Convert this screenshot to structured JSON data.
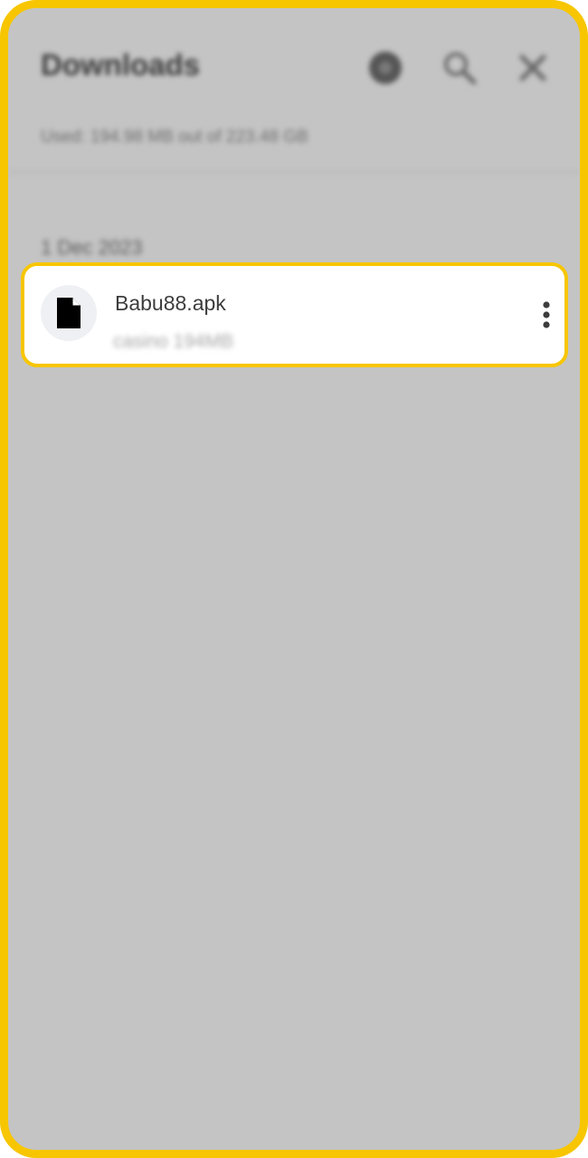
{
  "header": {
    "title": "Downloads",
    "icons": [
      "settings-icon",
      "search-icon",
      "close-icon"
    ]
  },
  "storage": {
    "text": "Used: 194.98 MB out of 223.48 GB"
  },
  "list": {
    "date_header": "1 Dec 2023",
    "items": [
      {
        "file_name": "Babu88.apk",
        "meta": "casino 194MB",
        "icon": "file-icon",
        "menu_icon": "more-vert-icon"
      }
    ]
  },
  "colors": {
    "highlight_border": "#f7c600",
    "overlay_background": "#c4c4c4",
    "card_background": "#ffffff"
  }
}
